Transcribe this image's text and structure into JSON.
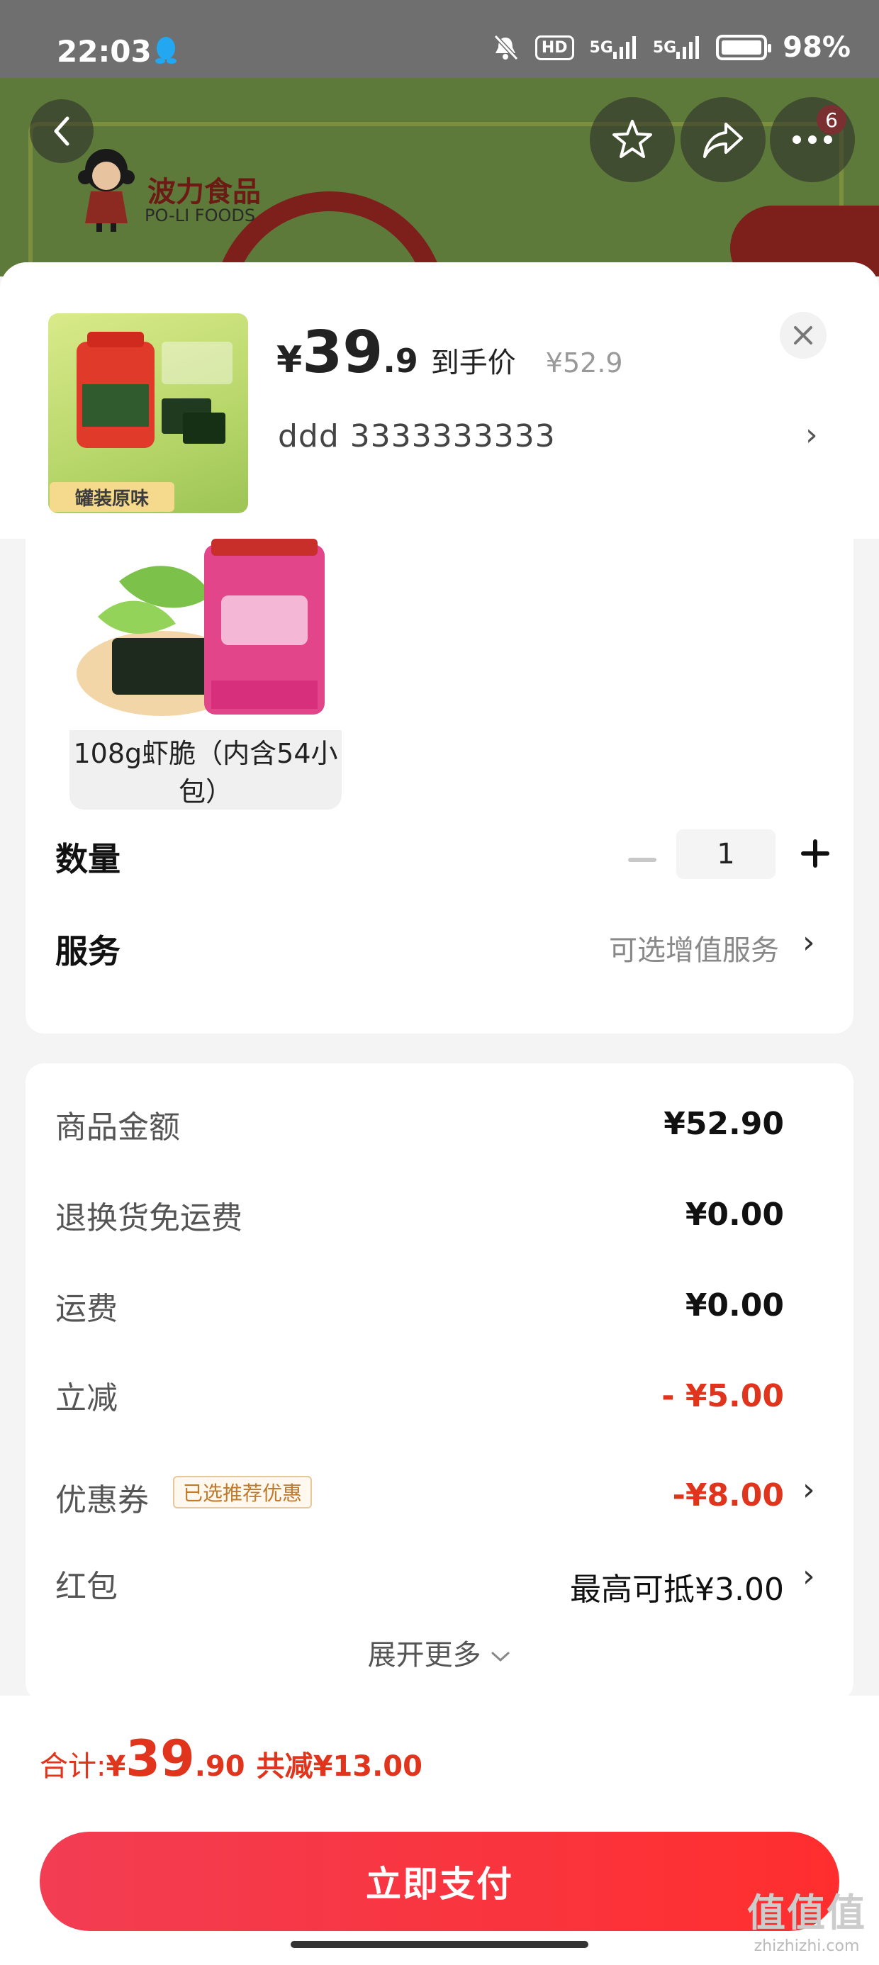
{
  "status_bar": {
    "time": "22:03",
    "hd_label": "HD",
    "network_1": "5G",
    "network_2": "5G",
    "battery": "98%"
  },
  "banner": {
    "brand_cn": "波力食品",
    "brand_en": "PO-LI FOODS",
    "cart_badge": "6"
  },
  "product": {
    "thumb_tag": "罐装原味",
    "price_yen": "¥",
    "price_int": "39",
    "price_dec": ".9",
    "price_label": "到手价",
    "original_price": "¥52.9",
    "address": "ddd  3333333333",
    "variant_label": "108g虾脆（内含54小包）"
  },
  "options": {
    "quantity_label": "数量",
    "quantity_value": "1",
    "service_label": "服务",
    "service_value": "可选增值服务"
  },
  "fees": {
    "goods_amount_label": "商品金额",
    "goods_amount": "¥52.90",
    "return_shipping_label": "退换货免运费",
    "return_shipping": "¥0.00",
    "shipping_label": "运费",
    "shipping": "¥0.00",
    "instant_discount_label": "立减",
    "instant_discount": "- ¥5.00",
    "coupon_label": "优惠券",
    "coupon_tag": "已选推荐优惠",
    "coupon_value": "-¥8.00",
    "red_packet_label": "红包",
    "red_packet_value": "最高可抵¥3.00",
    "expand_more": "展开更多"
  },
  "footer": {
    "total_label": "合计:",
    "total_yen": "¥",
    "total_int": "39",
    "total_dec": ".90",
    "total_saved": "共减¥13.00",
    "pay_button": "立即支付"
  },
  "watermark": {
    "big": "值值值",
    "small": "zhizhizhi.com"
  },
  "colors": {
    "accent_red": "#e0341d",
    "pay_button": "#f23d53"
  }
}
